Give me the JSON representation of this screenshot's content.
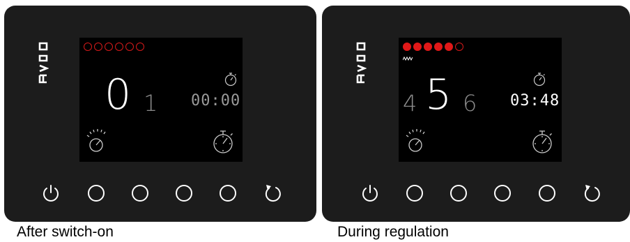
{
  "panels": [
    {
      "caption": "After switch-on",
      "status_dots": [
        false,
        false,
        false,
        false,
        false,
        false
      ],
      "digit_left": "",
      "digit_center": "0",
      "digit_right": "1",
      "timer": "00:00"
    },
    {
      "caption": "During regulation",
      "status_dots": [
        true,
        true,
        true,
        true,
        true,
        false
      ],
      "digit_left": "4",
      "digit_center": "5",
      "digit_right": "6",
      "timer": "03:48"
    }
  ],
  "colors": {
    "bezel": "#1c1c1c",
    "screen": "#000000",
    "led": "#e01818",
    "dim_text": "#8c8c8c",
    "timer_dim": "#9a9a9a",
    "timer_active": "#ffffff"
  },
  "icons": [
    "evco-logo-icon",
    "stopwatch-icon",
    "speed-dial-icon",
    "power-icon",
    "circle-button-icon",
    "restart-arrow-icon",
    "heating-wave-icon"
  ]
}
